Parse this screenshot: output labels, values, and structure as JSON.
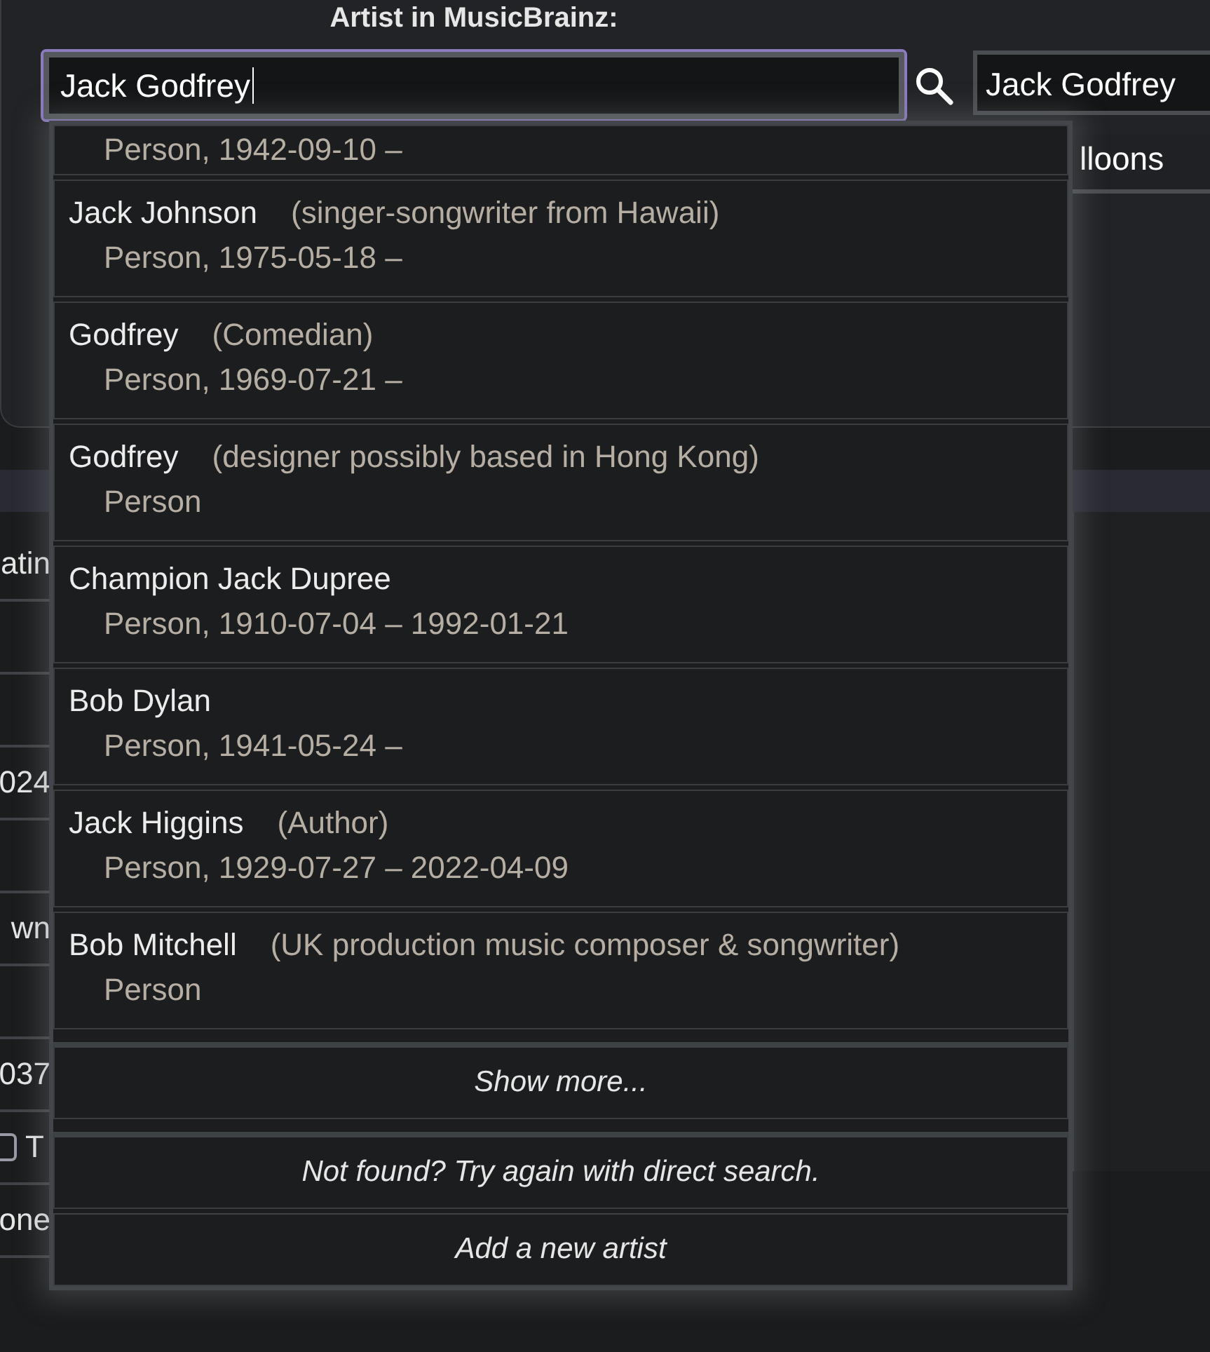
{
  "dialog": {
    "label": "Artist in MusicBrainz:",
    "search_field": {
      "value": "Jack Godfrey"
    },
    "name_field": {
      "value": "Jack Godfrey"
    },
    "second_field": {
      "value": "lloons"
    }
  },
  "background_rows": [
    {
      "kind": "text",
      "value": "atin"
    },
    {
      "kind": "empty"
    },
    {
      "kind": "empty"
    },
    {
      "kind": "text",
      "value": "024"
    },
    {
      "kind": "empty"
    },
    {
      "kind": "text",
      "value": "wn"
    },
    {
      "kind": "empty"
    },
    {
      "kind": "text",
      "value": "037"
    },
    {
      "kind": "checkbox",
      "label": "T",
      "checked": false
    },
    {
      "kind": "text",
      "value": "one"
    }
  ],
  "dropdown": {
    "results": [
      {
        "detail": "Person, 1942-09-10 –"
      },
      {
        "name": "Jack Johnson",
        "comment": "(singer-songwriter from Hawaii)",
        "detail": "Person, 1975-05-18 –"
      },
      {
        "name": "Godfrey",
        "comment": "(Comedian)",
        "detail": "Person, 1969-07-21 –"
      },
      {
        "name": "Godfrey",
        "comment": "(designer possibly based in Hong Kong)",
        "detail": "Person"
      },
      {
        "name": "Champion Jack Dupree",
        "detail": "Person, 1910-07-04 – 1992-01-21"
      },
      {
        "name": "Bob Dylan",
        "detail": "Person, 1941-05-24 –"
      },
      {
        "name": "Jack Higgins",
        "comment": "(Author)",
        "detail": "Person, 1929-07-27 – 2022-04-09"
      },
      {
        "name": "Bob Mitchell",
        "comment": "(UK production music composer & songwriter)",
        "detail": "Person"
      }
    ],
    "actions": [
      {
        "kind": "show_more",
        "label": "Show more..."
      },
      {
        "kind": "direct_search",
        "label": "Not found? Try again with direct search."
      },
      {
        "kind": "add",
        "label": "Add a new artist"
      }
    ]
  }
}
